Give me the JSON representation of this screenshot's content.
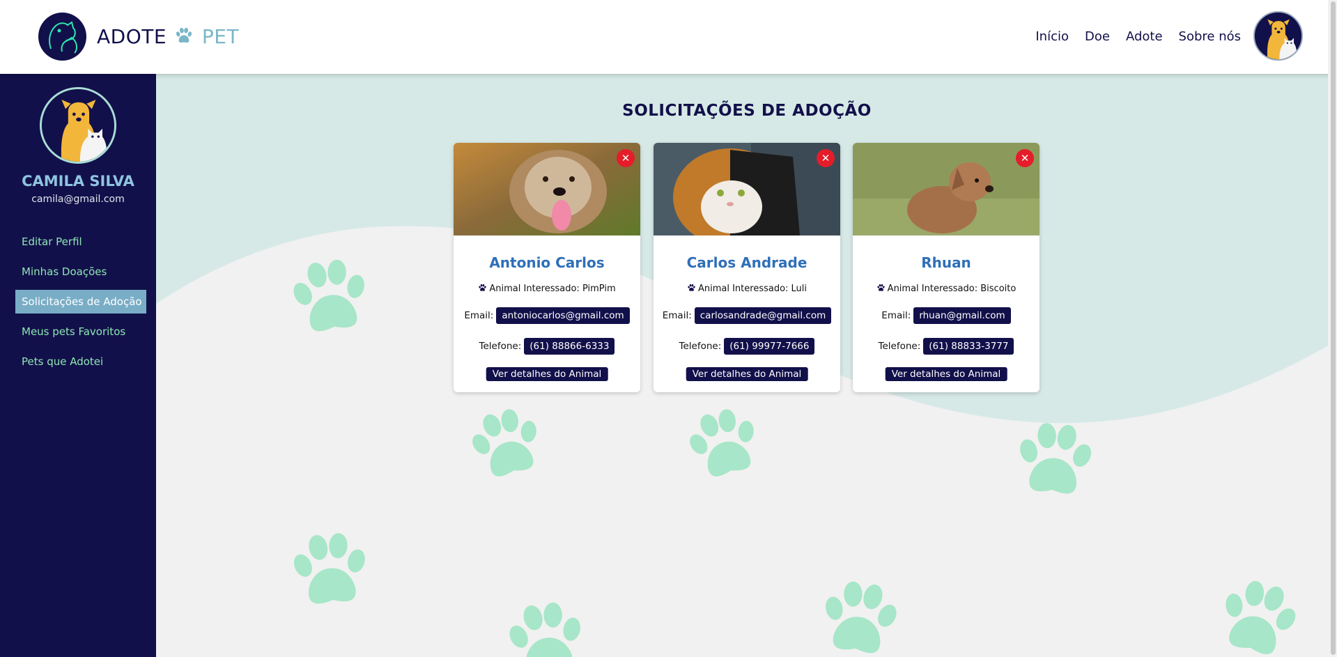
{
  "header": {
    "brand_part1": "ADOTE",
    "brand_part2": "PET",
    "nav": [
      "Início",
      "Doe",
      "Adote",
      "Sobre nós"
    ]
  },
  "sidebar": {
    "name": "CAMILA SILVA",
    "email": "camila@gmail.com",
    "items": [
      {
        "label": "Editar Perfil",
        "active": false
      },
      {
        "label": "Minhas Doações",
        "active": false
      },
      {
        "label": "Solicitações de Adoção",
        "active": true
      },
      {
        "label": "Meus pets Favoritos",
        "active": false
      },
      {
        "label": "Pets que Adotei",
        "active": false
      }
    ]
  },
  "main": {
    "title": "SOLICITAÇÕES DE ADOÇÃO",
    "cards": [
      {
        "name": "Antonio Carlos",
        "animal_label": "Animal Interessado: PimPim",
        "email_label": "Email:",
        "email": "antoniocarlos@gmail.com",
        "phone_label": "Telefone:",
        "phone": "(61) 88866-6333",
        "button": "Ver detalhes do Animal",
        "close": "✕"
      },
      {
        "name": "Carlos Andrade",
        "animal_label": "Animal Interessado: Luli",
        "email_label": "Email:",
        "email": "carlosandrade@gmail.com",
        "phone_label": "Telefone:",
        "phone": "(61) 99977-7666",
        "button": "Ver detalhes do Animal",
        "close": "✕"
      },
      {
        "name": "Rhuan",
        "animal_label": "Animal Interessado: Biscoito",
        "email_label": "Email:",
        "email": "rhuan@gmail.com",
        "phone_label": "Telefone:",
        "phone": "(61) 88833-3777",
        "button": "Ver detalhes do Animal",
        "close": "✕"
      }
    ]
  },
  "colors": {
    "navy": "#12104a",
    "accent_blue": "#2f6fb8",
    "sidebar_active": "#79adc6",
    "sidebar_link": "#8de6b4",
    "paw_green": "#a7e6c8",
    "close_red": "#e51d2a"
  }
}
